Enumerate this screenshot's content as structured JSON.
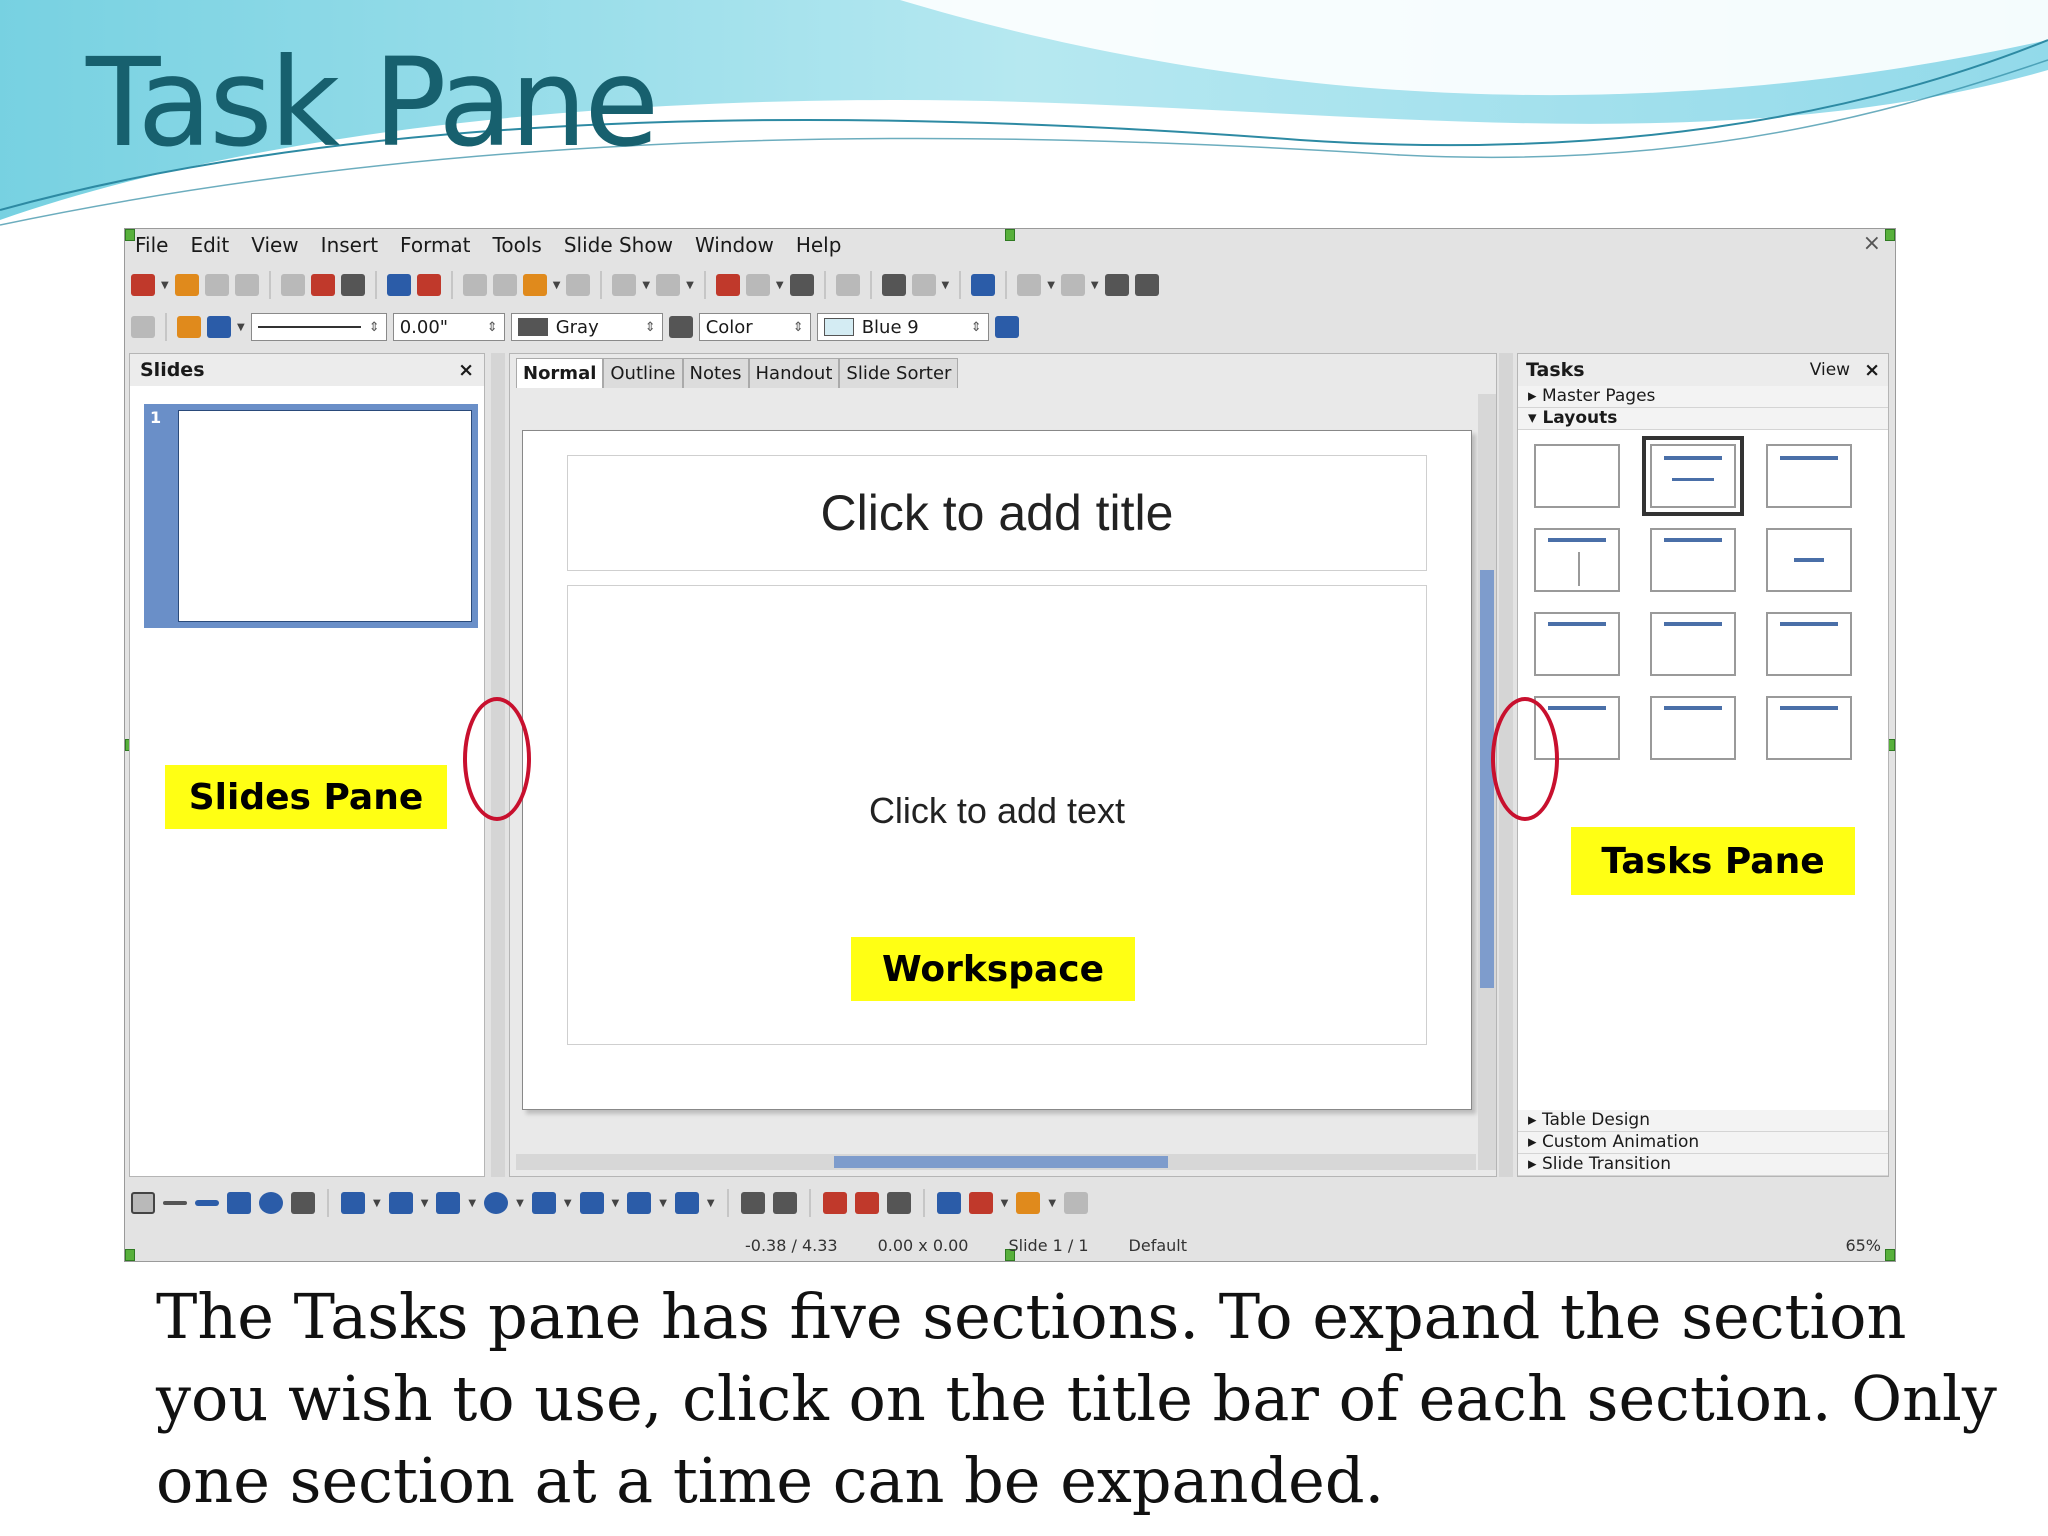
{
  "slide": {
    "title": "Task Pane",
    "caption": "The Tasks pane has five sections. To expand the section you wish to use, click on the title bar of each section. Only one section at a time can be expanded."
  },
  "app": {
    "menu": [
      "File",
      "Edit",
      "View",
      "Insert",
      "Format",
      "Tools",
      "Slide Show",
      "Window",
      "Help"
    ],
    "toolbar2": {
      "line_width": "0.00\"",
      "line_color": "Gray",
      "area_style": "Color",
      "area_color": "Blue 9"
    },
    "slides_pane": {
      "title": "Slides",
      "close": "×",
      "slide_number": "1"
    },
    "view_tabs": [
      "Normal",
      "Outline",
      "Notes",
      "Handout",
      "Slide Sorter"
    ],
    "slide_page": {
      "title_placeholder": "Click to add title",
      "body_placeholder": "Click to add text"
    },
    "tasks_pane": {
      "title": "Tasks",
      "view_menu": "View",
      "close": "×",
      "sections_top": [
        "Master Pages",
        "Layouts"
      ],
      "sections_bottom": [
        "Table Design",
        "Custom Animation",
        "Slide Transition"
      ]
    },
    "status": {
      "position": "-0.38 / 4.33",
      "size": "0.00 x 0.00",
      "slide": "Slide 1 / 1",
      "master": "Default",
      "zoom": "65%"
    }
  },
  "annotations": {
    "slides_pane": "Slides Pane",
    "workspace": "Workspace",
    "tasks_pane": "Tasks Pane"
  },
  "colors": {
    "title": "#17606e",
    "callout": "#ffff14",
    "ring": "#c8102e",
    "accent": "#4a6fa8"
  }
}
